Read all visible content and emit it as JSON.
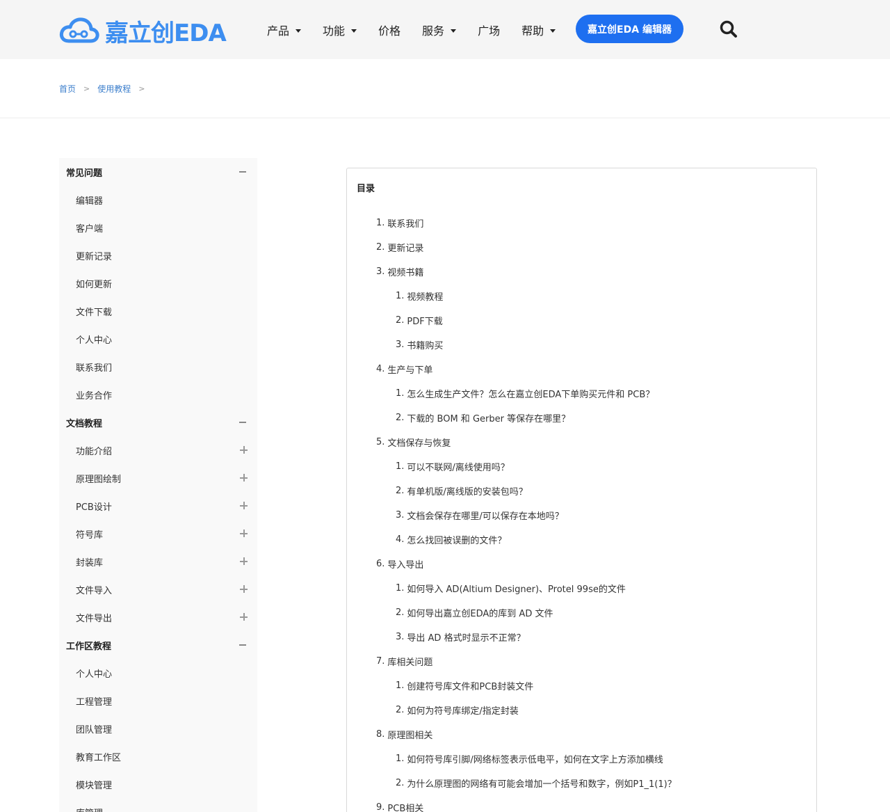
{
  "header": {
    "logo_text": "嘉立创EDA",
    "nav": [
      {
        "label": "产品",
        "dropdown": true
      },
      {
        "label": "功能",
        "dropdown": true
      },
      {
        "label": "价格",
        "dropdown": false
      },
      {
        "label": "服务",
        "dropdown": true
      },
      {
        "label": "广场",
        "dropdown": false
      },
      {
        "label": "帮助",
        "dropdown": true
      }
    ],
    "editor_button": "嘉立创EDA 编辑器",
    "accent_color": "#1e6ff0"
  },
  "breadcrumb": [
    "首页",
    "使用教程"
  ],
  "sidebar": {
    "groups": [
      {
        "label": "常见问题",
        "items": [
          "编辑器",
          "客户端",
          "更新记录",
          "如何更新",
          "文件下载",
          "个人中心",
          "联系我们",
          "业务合作"
        ],
        "expandable_items": false
      },
      {
        "label": "文档教程",
        "items": [
          "功能介绍",
          "原理图绘制",
          "PCB设计",
          "符号库",
          "封装库",
          "文件导入",
          "文件导出"
        ],
        "expandable_items": true
      },
      {
        "label": "工作区教程",
        "items": [
          "个人中心",
          "工程管理",
          "团队管理",
          "教育工作区",
          "模块管理",
          "库管理"
        ],
        "expandable_items": false
      }
    ]
  },
  "toc": {
    "title": "目录",
    "items": [
      {
        "num": "1.",
        "label": "联系我们",
        "children": []
      },
      {
        "num": "2.",
        "label": "更新记录",
        "children": []
      },
      {
        "num": "3.",
        "label": "视频书籍",
        "children": [
          {
            "num": "1.",
            "label": "视频教程"
          },
          {
            "num": "2.",
            "label": "PDF下载"
          },
          {
            "num": "3.",
            "label": "书籍购买"
          }
        ]
      },
      {
        "num": "4.",
        "label": "生产与下单",
        "children": [
          {
            "num": "1.",
            "label": "怎么生成生产文件？怎么在嘉立创EDA下单购买元件和 PCB？"
          },
          {
            "num": "2.",
            "label": "下载的 BOM 和 Gerber 等保存在哪里？"
          }
        ]
      },
      {
        "num": "5.",
        "label": "文档保存与恢复",
        "children": [
          {
            "num": "1.",
            "label": "可以不联网/离线使用吗？"
          },
          {
            "num": "2.",
            "label": "有单机版/离线版的安装包吗？"
          },
          {
            "num": "3.",
            "label": "文档会保存在哪里/可以保存在本地吗？"
          },
          {
            "num": "4.",
            "label": "怎么找回被误删的文件？"
          }
        ]
      },
      {
        "num": "6.",
        "label": "导入导出",
        "children": [
          {
            "num": "1.",
            "label": "如何导入 AD(Altium Designer)、Protel 99se的文件"
          },
          {
            "num": "2.",
            "label": "如何导出嘉立创EDA的库到 AD 文件"
          },
          {
            "num": "3.",
            "label": "导出 AD 格式时显示不正常？"
          }
        ]
      },
      {
        "num": "7.",
        "label": "库相关问题",
        "children": [
          {
            "num": "1.",
            "label": "创建符号库文件和PCB封装文件"
          },
          {
            "num": "2.",
            "label": "如何为符号库绑定/指定封装"
          }
        ]
      },
      {
        "num": "8.",
        "label": "原理图相关",
        "children": [
          {
            "num": "1.",
            "label": "如何符号库引脚/网络标签表示低电平，如何在文字上方添加横线"
          },
          {
            "num": "2.",
            "label": "为什么原理图的网络有可能会增加一个括号和数字，例如P1_1(1)？"
          }
        ]
      },
      {
        "num": "9.",
        "label": "PCB相关",
        "children": []
      }
    ]
  }
}
